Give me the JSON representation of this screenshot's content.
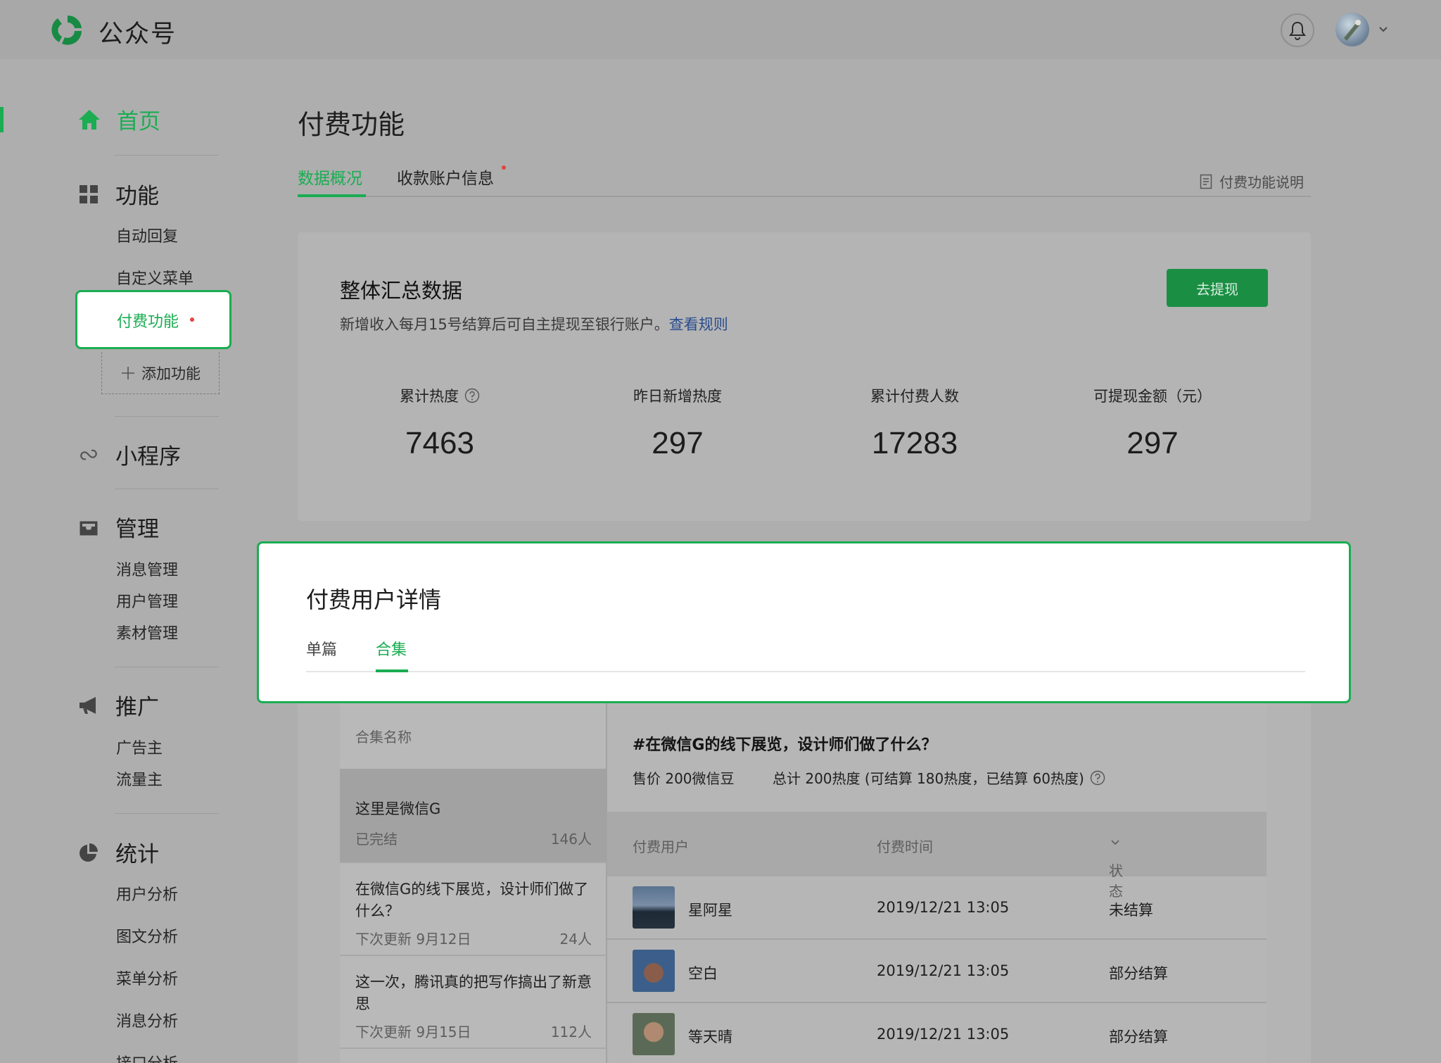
{
  "app": {
    "title": "公众号"
  },
  "colors": {
    "accent": "#1aad52",
    "alert_dot": "#e64340",
    "link": "#294c8e"
  },
  "sidebar": {
    "home": "首页",
    "groups": [
      {
        "label": "功能",
        "icon": "grid-icon",
        "items": [
          "自动回复",
          "自定义菜单",
          "付费功能"
        ],
        "add": "添加功能"
      },
      {
        "label": "小程序",
        "icon": "link-icon",
        "items": []
      },
      {
        "label": "管理",
        "icon": "inbox-icon",
        "items": [
          "消息管理",
          "用户管理",
          "素材管理"
        ]
      },
      {
        "label": "推广",
        "icon": "megaphone-icon",
        "items": [
          "广告主",
          "流量主"
        ]
      },
      {
        "label": "统计",
        "icon": "pie-chart-icon",
        "items": [
          "用户分析",
          "图文分析",
          "菜单分析",
          "消息分析",
          "接口分析"
        ]
      }
    ]
  },
  "page": {
    "title": "付费功能",
    "tabs": [
      "数据概况",
      "收款账户信息"
    ],
    "help": "付费功能说明"
  },
  "summary": {
    "title": "整体汇总数据",
    "desc": "新增收入每月15号结算后可自主提现至银行账户。",
    "rule_link": "查看规则",
    "button": "去提现",
    "stats": [
      {
        "label": "累计热度",
        "value": "7463"
      },
      {
        "label": "昨日新增热度",
        "value": "297"
      },
      {
        "label": "累计付费人数",
        "value": "17283"
      },
      {
        "label": "可提现金额（元）",
        "value": "297"
      }
    ]
  },
  "detail_panel": {
    "title": "付费用户详情",
    "tabs": [
      "单篇",
      "合集"
    ],
    "active_tab": "合集"
  },
  "collections": {
    "header": "合集名称",
    "items": [
      {
        "name": "这里是微信G",
        "sub": "已完结",
        "count": "146人"
      },
      {
        "name": "在微信G的线下展览，设计师们做了什么？",
        "sub": "下次更新 9月12日",
        "count": "24人"
      },
      {
        "name": "这一次，腾讯真的把写作搞出了新意思",
        "sub": "下次更新 9月15日",
        "count": "112人"
      }
    ]
  },
  "detail": {
    "title": "#在微信G的线下展览，设计师们做了什么？",
    "price": "售价 200微信豆",
    "total": "总计 200热度 (可结算 180热度，已结算 60热度)",
    "columns": [
      "付费用户",
      "付费时间",
      "状态"
    ],
    "rows": [
      {
        "user": "星阿星",
        "time": "2019/12/21 13:05",
        "status": "未结算"
      },
      {
        "user": "空白",
        "time": "2019/12/21 13:05",
        "status": "部分结算"
      },
      {
        "user": "等天晴",
        "time": "2019/12/21 13:05",
        "status": "部分结算"
      }
    ]
  }
}
